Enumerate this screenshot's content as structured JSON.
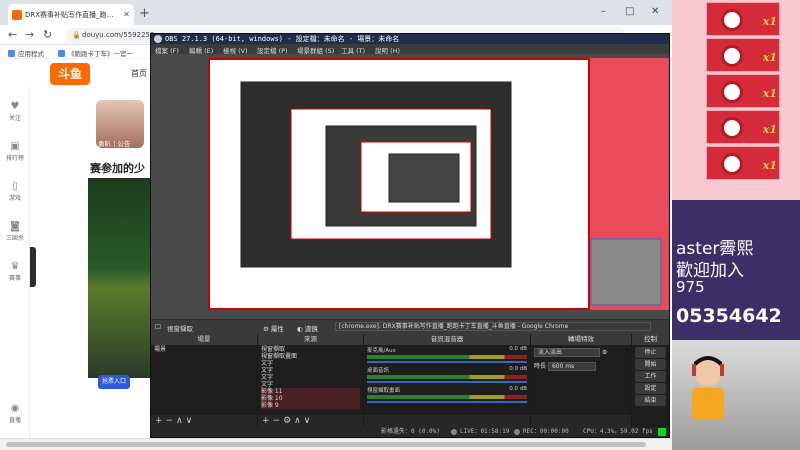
{
  "browser": {
    "tab_title": "DRX赛事补贴写作直播_跑跑卡丁车直播_斗鱼直播",
    "url": "douyu.com/5592259",
    "bookmarks": [
      "应用程式",
      "《跑跑卡丁车》一官一"
    ],
    "win_min": "–",
    "win_max": "□",
    "win_close": "✕",
    "new_tab": "+"
  },
  "douyu": {
    "logo": "斗鱼",
    "home": "首页",
    "streamer_name": "勇叭 | 公告",
    "title": "赛参加的少",
    "player_button": "抢票入口",
    "sidebar": [
      "关注",
      "排行榜",
      "游戏",
      "三国杀",
      "赛事"
    ],
    "sidebar_bottom": "直播"
  },
  "obs": {
    "title": "OBS 27.1.3 (64-bit, windows) - 設定檔：未命名 - 場景：未命名",
    "menu": [
      "檔案 (F)",
      "編輯 (E)",
      "檢視 (V)",
      "設定檔 (P)",
      "場景群組 (S)",
      "工具 (T)",
      "說明 (H)"
    ],
    "source_bar": {
      "selected": "視窗擷取",
      "properties": "屬性",
      "filters": "濾鏡",
      "window": "[chrome.exe]: DRX赛事补贴写作直播_跑跑卡丁车直播_斗鱼直播 - Google Chrome"
    },
    "docks": {
      "scenes": {
        "title": "場景",
        "items": [
          "場景"
        ]
      },
      "sources": {
        "title": "來源",
        "items": [
          "視窗擷取",
          "視窗擷取畫面",
          "文字",
          "文字",
          "文字",
          "文字",
          "影像 11",
          "影像 10",
          "影像 9"
        ]
      },
      "mixer": {
        "title": "音訊混音器",
        "channels": [
          {
            "name": "麥克風/Aux",
            "db": "0.0 dB"
          },
          {
            "name": "桌面音訊",
            "db": "0.0 dB"
          },
          {
            "name": "視窗擷取畫面",
            "db": "0.0 dB"
          }
        ]
      },
      "transitions": {
        "title": "轉場特效",
        "type": "淡入淡出",
        "duration_label": "時長",
        "duration": "600 ms"
      },
      "controls": {
        "title": "控制",
        "buttons": [
          "停止",
          "開始",
          "工作",
          "設定",
          "結束"
        ]
      }
    },
    "status": {
      "dropped": "影格遺失：0 (0.0%)",
      "live": "LIVE：01:58:19",
      "rec": "REC：00:00:00",
      "cpu": "CPU：4.3%，59.02 fps"
    }
  },
  "overlay": {
    "gift_count": "x1",
    "lines": [
      "aster霽熙",
      "歡迎加入",
      "975",
      "05354642"
    ],
    "colors": {
      "gift_bg": "#d52b3a",
      "overlay_panel": "#3a2f66"
    }
  }
}
